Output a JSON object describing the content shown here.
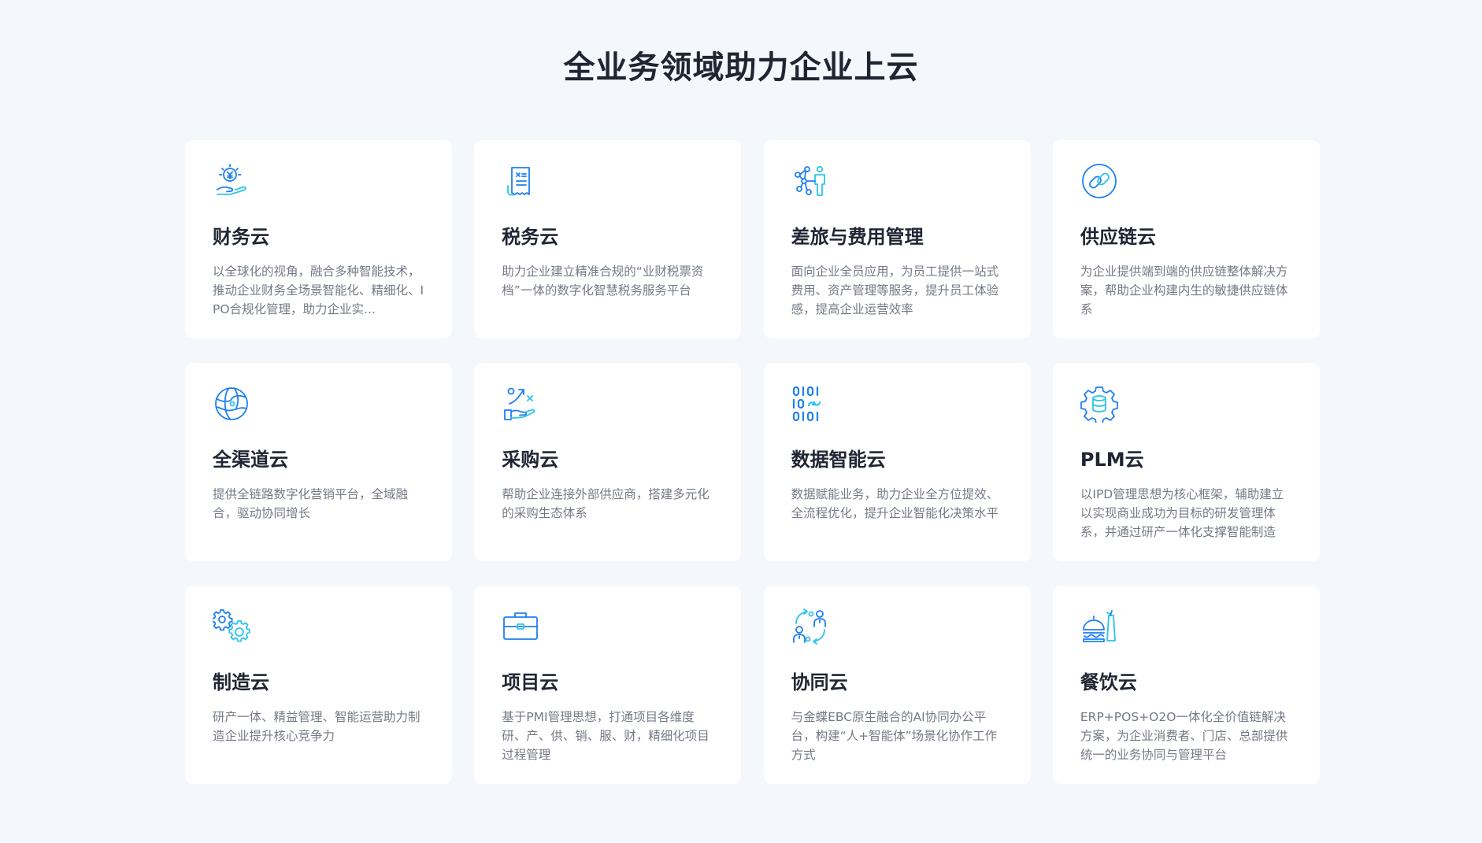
{
  "page": {
    "title": "全业务领域助力企业上云"
  },
  "theme": {
    "background": "#f4f7fc",
    "card_background": "#ffffff",
    "title_color": "#1f2633",
    "desc_color": "#747a85",
    "icon_primary": "#1e7ff0",
    "icon_secondary": "#2bc4e8"
  },
  "cards": [
    {
      "icon": "finance-coin-hand-icon",
      "title": "财务云",
      "desc": "以全球化的视角，融合多种智能技术，推动企业财务全场景智能化、精细化、IPO合规化管理，助力企业实..."
    },
    {
      "icon": "tax-receipt-icon",
      "title": "税务云",
      "desc": "助力企业建立精准合规的“业财税票资档”一体的数字化智慧税务服务平台"
    },
    {
      "icon": "travel-network-person-icon",
      "title": "差旅与费用管理",
      "desc": "面向企业全员应用，为员工提供一站式费用、资产管理等服务，提升员工体验感，提高企业运营效率"
    },
    {
      "icon": "chain-link-icon",
      "title": "供应链云",
      "desc": "为企业提供端到端的供应链整体解决方案，帮助企业构建内生的敏捷供应链体系"
    },
    {
      "icon": "globe-icon",
      "title": "全渠道云",
      "desc": "提供全链路数字化营销平台，全域融合，驱动协同增长"
    },
    {
      "icon": "procurement-hand-icon",
      "title": "采购云",
      "desc": "帮助企业连接外部供应商，搭建多元化的采购生态体系"
    },
    {
      "icon": "binary-data-icon",
      "title": "数据智能云",
      "desc": "数据赋能业务，助力企业全方位提效、全流程优化，提升企业智能化决策水平"
    },
    {
      "icon": "gear-database-icon",
      "title": "PLM云",
      "desc": "以IPD管理思想为核心框架，辅助建立以实现商业成功为目标的研发管理体系，并通过研产一体化支撑智能制造"
    },
    {
      "icon": "gears-icon",
      "title": "制造云",
      "desc": "研产一体、精益管理、智能运营助力制造企业提升核心竞争力"
    },
    {
      "icon": "briefcase-icon",
      "title": "项目云",
      "desc": "基于PMI管理思想，打通项目各维度研、产、供、销、服、财，精细化项目过程管理"
    },
    {
      "icon": "collaboration-people-icon",
      "title": "协同云",
      "desc": "与金蝶EBC原生融合的AI协同办公平台，构建“人+智能体”场景化协作工作方式"
    },
    {
      "icon": "catering-food-icon",
      "title": "餐饮云",
      "desc": "ERP+POS+O2O一体化全价值链解决方案，为企业消费者、门店、总部提供统一的业务协同与管理平台"
    }
  ]
}
